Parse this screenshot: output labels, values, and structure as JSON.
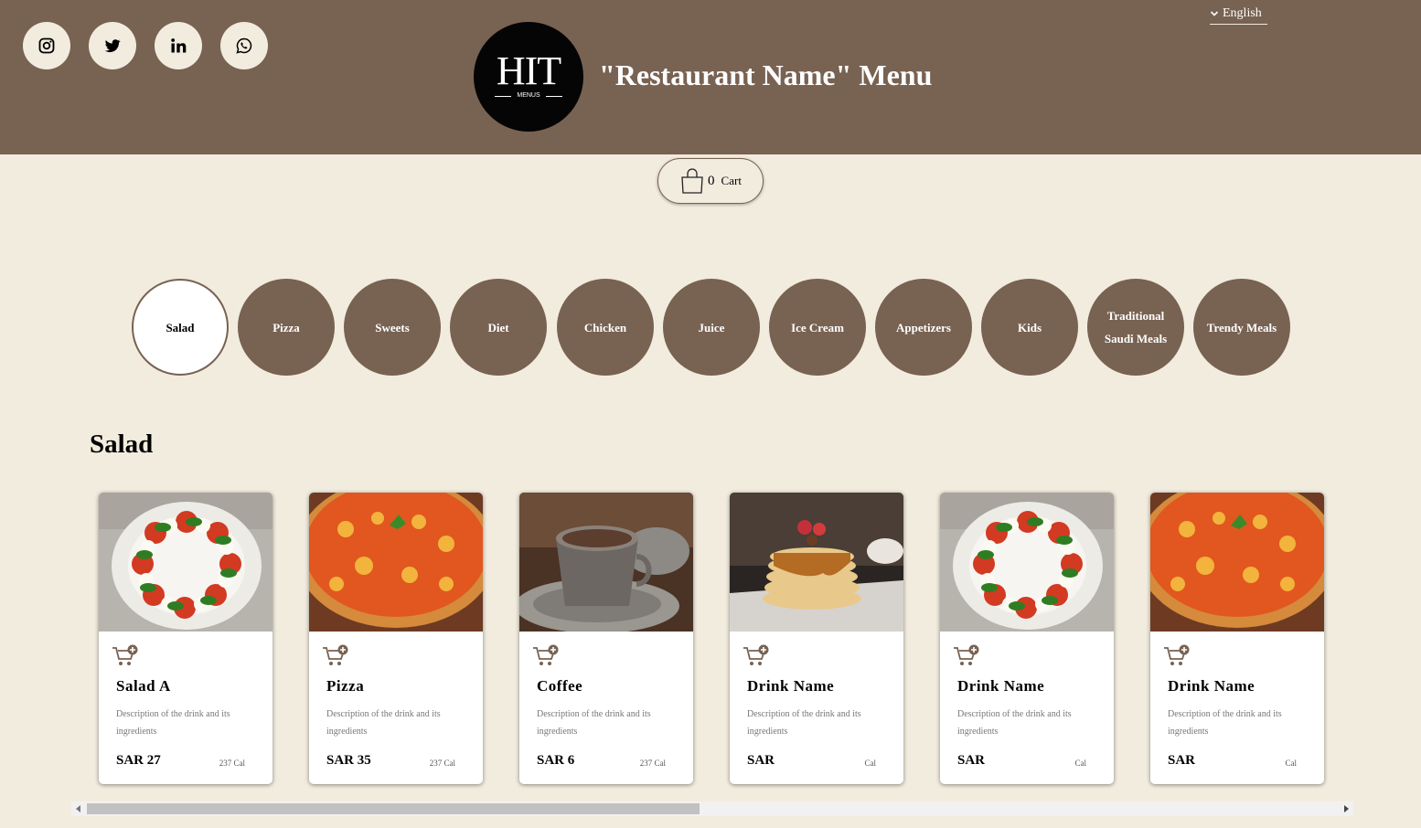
{
  "header": {
    "title": "\"Restaurant Name\" Menu",
    "logo_text": "HIT",
    "logo_subtext": "MENUS",
    "language": "English",
    "social": [
      "instagram-icon",
      "twitter-icon",
      "linkedin-icon",
      "whatsapp-icon"
    ]
  },
  "cart": {
    "count": "0",
    "label": "Cart"
  },
  "categories": [
    {
      "label": "Salad",
      "active": true
    },
    {
      "label": "Pizza",
      "active": false
    },
    {
      "label": "Sweets",
      "active": false
    },
    {
      "label": "Diet",
      "active": false
    },
    {
      "label": "Chicken",
      "active": false
    },
    {
      "label": "Juice",
      "active": false
    },
    {
      "label": "Ice Cream",
      "active": false
    },
    {
      "label": "Appetizers",
      "active": false
    },
    {
      "label": "Kids",
      "active": false
    },
    {
      "label": "Traditional Saudi Meals",
      "active": false
    },
    {
      "label": "Trendy Meals",
      "active": false
    }
  ],
  "section_title": "Salad",
  "products": [
    {
      "name": "Salad A",
      "description": "Description of the drink and its ingredients",
      "price": "SAR 27",
      "calories": "237 Cal",
      "image": "caprese-salad-image"
    },
    {
      "name": "Pizza",
      "description": "Description of the drink and its ingredients",
      "price": "SAR 35",
      "calories": "237 Cal",
      "image": "pizza-image"
    },
    {
      "name": "Coffee",
      "description": "Description of the drink and its ingredients",
      "price": "SAR 6",
      "calories": "237 Cal",
      "image": "coffee-image"
    },
    {
      "name": "Drink Name",
      "description": "Description of the drink and its ingredients",
      "price": "SAR",
      "calories": "Cal",
      "image": "pancakes-image"
    },
    {
      "name": "Drink Name",
      "description": "Description of the drink and its ingredients",
      "price": "SAR",
      "calories": "Cal",
      "image": "caprese-salad-image"
    },
    {
      "name": "Drink Name",
      "description": "Description of the drink and its ingredients",
      "price": "SAR",
      "calories": "Cal",
      "image": "pizza-image"
    }
  ],
  "scrollbar": {
    "position_fraction": 0,
    "visible_fraction": 0.49
  },
  "colors": {
    "brand": "#786252",
    "background": "#f2ecdf",
    "card": "#ffffff"
  }
}
